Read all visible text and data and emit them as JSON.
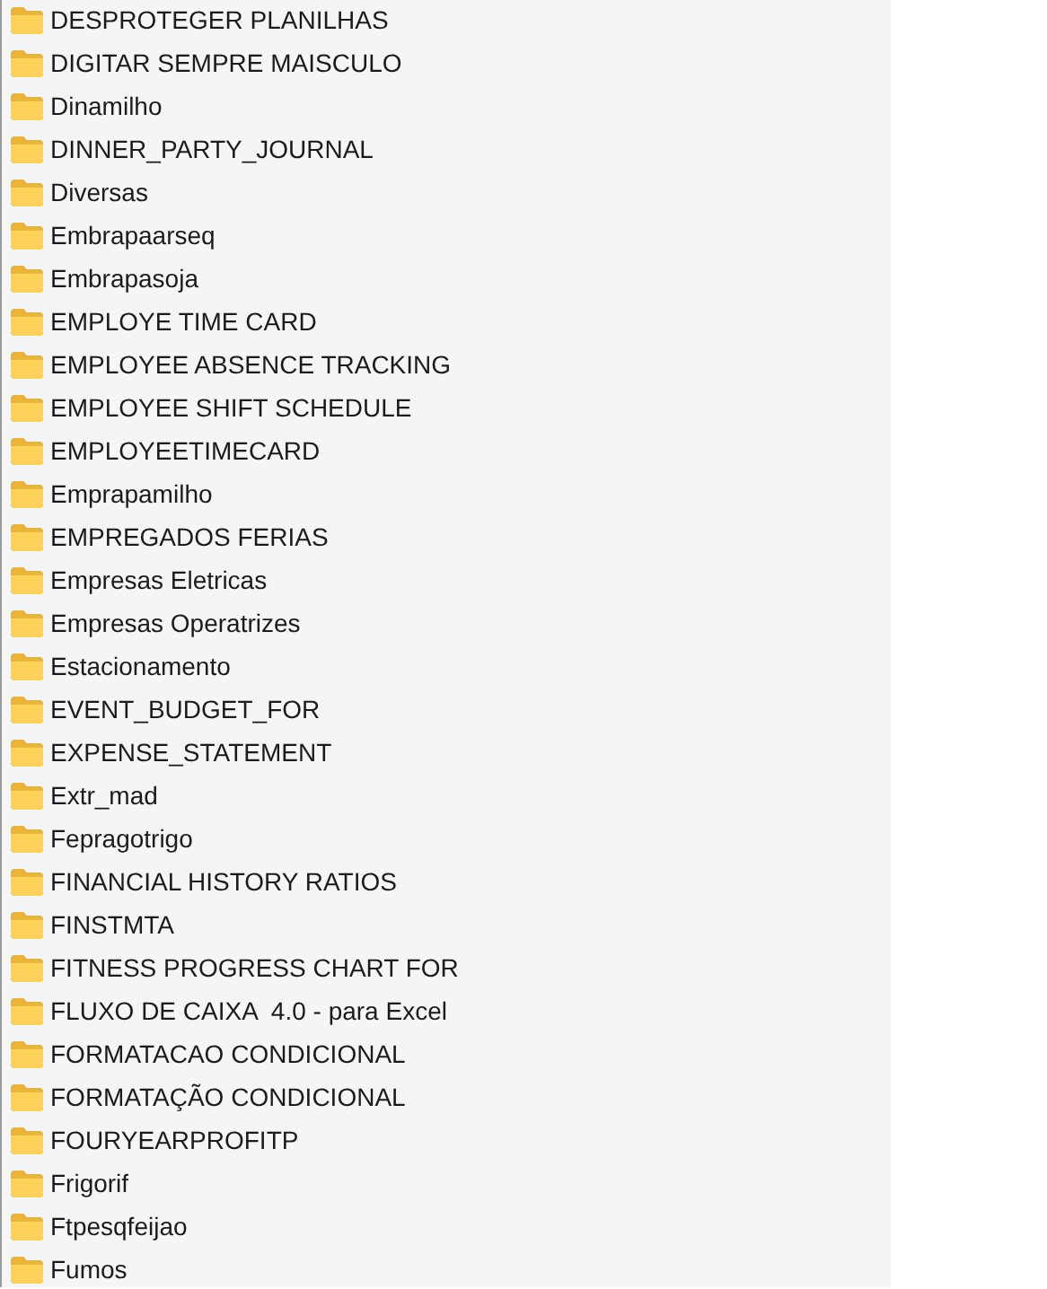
{
  "folders": [
    {
      "name": "DESPROTEGER PLANILHAS"
    },
    {
      "name": "DIGITAR SEMPRE MAISCULO"
    },
    {
      "name": "Dinamilho"
    },
    {
      "name": "DINNER_PARTY_JOURNAL"
    },
    {
      "name": "Diversas"
    },
    {
      "name": "Embrapaarseq"
    },
    {
      "name": "Embrapasoja"
    },
    {
      "name": "EMPLOYE TIME CARD"
    },
    {
      "name": "EMPLOYEE ABSENCE TRACKING"
    },
    {
      "name": "EMPLOYEE SHIFT SCHEDULE"
    },
    {
      "name": "EMPLOYEETIMECARD"
    },
    {
      "name": "Emprapamilho"
    },
    {
      "name": "EMPREGADOS FERIAS"
    },
    {
      "name": "Empresas Eletricas"
    },
    {
      "name": "Empresas Operatrizes"
    },
    {
      "name": "Estacionamento"
    },
    {
      "name": "EVENT_BUDGET_FOR"
    },
    {
      "name": "EXPENSE_STATEMENT"
    },
    {
      "name": "Extr_mad"
    },
    {
      "name": "Fepragotrigo"
    },
    {
      "name": "FINANCIAL HISTORY RATIOS"
    },
    {
      "name": "FINSTMTA"
    },
    {
      "name": "FITNESS PROGRESS CHART FOR"
    },
    {
      "name": "FLUXO DE CAIXA  4.0 - para Excel"
    },
    {
      "name": "FORMATACAO CONDICIONAL"
    },
    {
      "name": "FORMATAÇÃO CONDICIONAL"
    },
    {
      "name": "FOURYEARPROFITP"
    },
    {
      "name": "Frigorif"
    },
    {
      "name": "Ftpesqfeijao"
    },
    {
      "name": "Fumos"
    }
  ]
}
